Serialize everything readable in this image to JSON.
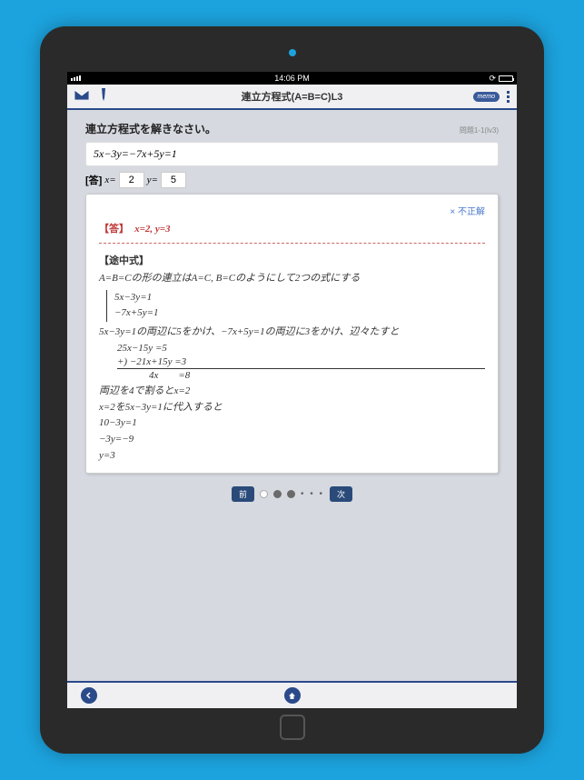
{
  "status": {
    "time": "14:06 PM"
  },
  "header": {
    "title": "連立方程式(A=B=C)L3",
    "memo": "memo"
  },
  "problem": {
    "instruction": "連立方程式を解きなさい。",
    "id": "問題1-1(lv3)",
    "equation": "5x−3y=−7x+5y=1"
  },
  "answer": {
    "label": "[答]",
    "x_label": "x=",
    "x_value": "2",
    "y_label": "y=",
    "y_value": "5"
  },
  "result": {
    "incorrect": "× 不正解",
    "correct_label": "【答】",
    "correct_value": "x=2, y=3"
  },
  "method": {
    "title": "【途中式】",
    "intro": "A=B=Cの形の連立はA=C, B=Cのようにして2つの式にする",
    "sys1": "5x−3y=1",
    "sys2": "−7x+5y=1",
    "step1": "5x−3y=1の両辺に5をかけ、−7x+5y=1の両辺に3をかけ、辺々たすと",
    "calc_top": "25x−15y =5",
    "calc_plus": "+) −21x+15y =3",
    "calc_bot": "4x　　=8",
    "step2": "両辺を4で割るとx=2",
    "step3": "x=2を5x−3y=1に代入すると",
    "step4": "10−3y=1",
    "step5": "−3y=−9",
    "step6": "y=3"
  },
  "pager": {
    "prev": "前",
    "next": "次",
    "ellipsis": "• • •"
  }
}
